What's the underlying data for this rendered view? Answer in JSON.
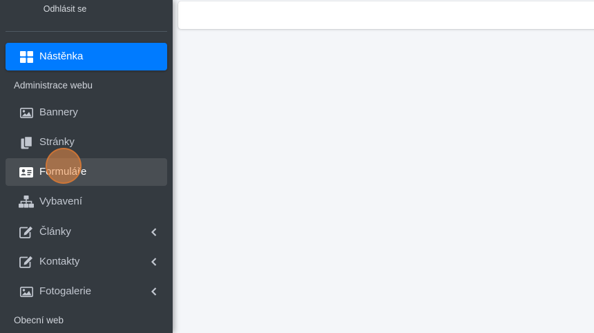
{
  "sidebar": {
    "logout_label": "Odhlásit se",
    "items": [
      {
        "label": "Nástěnka",
        "icon": "dashboard-icon"
      },
      {
        "label": "Bannery",
        "icon": "image-icon"
      },
      {
        "label": "Stránky",
        "icon": "copy-icon"
      },
      {
        "label": "Formuláře",
        "icon": "id-card-icon"
      },
      {
        "label": "Vybavení",
        "icon": "sitemap-icon"
      },
      {
        "label": "Články",
        "icon": "edit-icon"
      },
      {
        "label": "Kontakty",
        "icon": "edit-icon"
      },
      {
        "label": "Fotogalerie",
        "icon": "image-icon"
      }
    ],
    "headers": {
      "admin": "Administrace webu",
      "public": "Obecní web"
    }
  },
  "colors": {
    "sidebar_bg": "#343a40",
    "active_bg": "#007bff",
    "hover_bg": "#494e53",
    "content_bg": "#f4f6f9",
    "cursor": "#ec8c46"
  }
}
